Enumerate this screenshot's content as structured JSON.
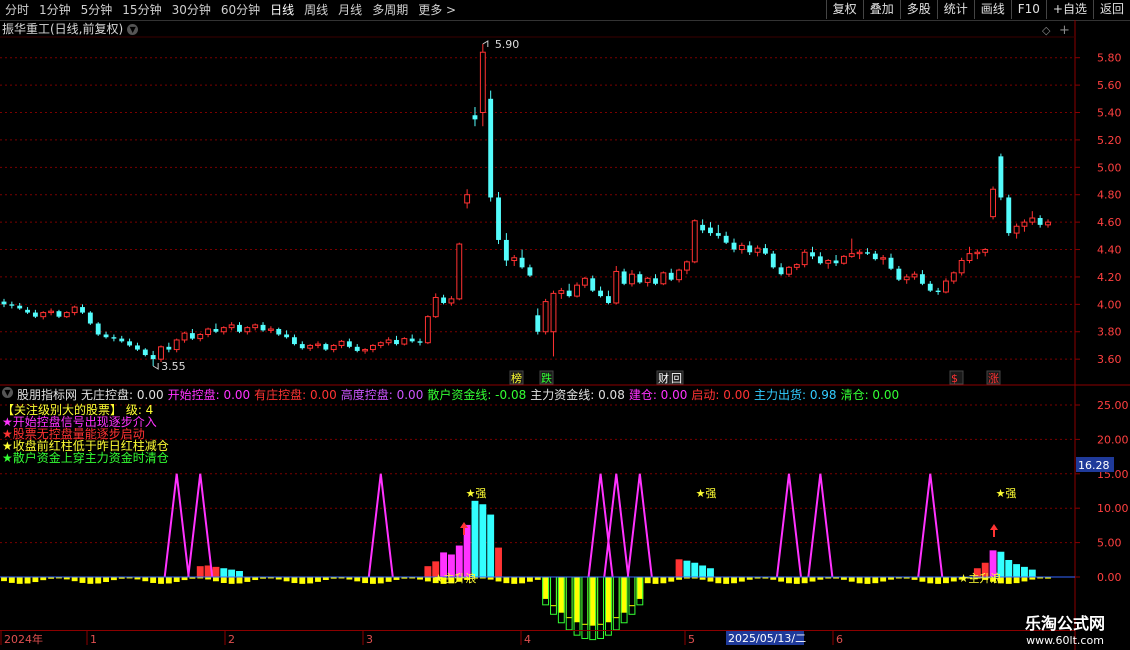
{
  "toolbar": {
    "periods": [
      "分时",
      "1分钟",
      "5分钟",
      "15分钟",
      "30分钟",
      "60分钟",
      "日线",
      "周线",
      "月线",
      "多周期",
      "更多 >"
    ],
    "active_period": "日线",
    "buttons": [
      "复权",
      "叠加",
      "多股",
      "统计",
      "画线",
      "F10",
      "+自选",
      "返回"
    ]
  },
  "main_chart": {
    "title": "振华重工(日线,前复权)",
    "y_ticks": [
      "5.80",
      "5.60",
      "5.40",
      "5.20",
      "5.00",
      "4.80",
      "4.60",
      "4.40",
      "4.20",
      "4.00",
      "3.80",
      "3.60"
    ],
    "high_label": "5.90",
    "low_label": "3.55",
    "markers": [
      "榜",
      "跌",
      "财",
      "回",
      "$",
      "涨"
    ]
  },
  "indicator": {
    "name": "股朋指标网",
    "values": [
      {
        "label": "无庄控盘:",
        "value": "0.00",
        "color": "#e0e0e0"
      },
      {
        "label": "开始控盘:",
        "value": "0.00",
        "color": "#ff33ff"
      },
      {
        "label": "有庄控盘:",
        "value": "0.00",
        "color": "#ff3333"
      },
      {
        "label": "高度控盘:",
        "value": "0.00",
        "color": "#cc55ff"
      },
      {
        "label": "散户资金线:",
        "value": "-0.08",
        "color": "#33ff33"
      },
      {
        "label": "主力资金线:",
        "value": "0.08",
        "color": "#e0e0e0"
      },
      {
        "label": "建仓:",
        "value": "0.00",
        "color": "#ff33ff"
      },
      {
        "label": "启动:",
        "value": "0.00",
        "color": "#ff3333"
      },
      {
        "label": "主力出货:",
        "value": "0.98",
        "color": "#33ccff"
      },
      {
        "label": "清仓:",
        "value": "0.00",
        "color": "#33ff33"
      }
    ],
    "legend": [
      {
        "text": "【关注级别大的股票】    级:",
        "value": "4",
        "color": "#ffff33"
      },
      {
        "text": "★开始控盘信号出现逐步介入",
        "color": "#ff33ff"
      },
      {
        "text": "★股票无控盘量能逐步启动",
        "color": "#ff3333"
      },
      {
        "text": "★收盘前红柱低于昨日红柱减仓",
        "color": "#ffff33"
      },
      {
        "text": "★散户资金上穿主力资金时清仓",
        "color": "#33ff33"
      }
    ],
    "y_ticks": [
      "25.00",
      "20.00",
      "15.00",
      "10.00",
      "5.00",
      "0.00"
    ],
    "current_value": "16.28",
    "annotations": {
      "strong": "★强",
      "main_up": "★主升浪"
    }
  },
  "x_axis": {
    "labels": [
      "2024年",
      "1",
      "2",
      "3",
      "4",
      "5",
      "6"
    ],
    "highlight": "2025/05/13/二"
  },
  "watermark": {
    "line1": "乐淘公式网",
    "line2": "www.60lt.com"
  }
}
